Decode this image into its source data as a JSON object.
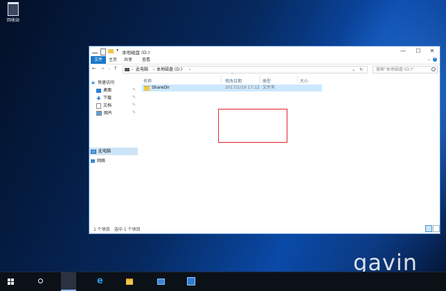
{
  "desktop": {
    "recycle_bin_label": "回收站",
    "watermark": "gavin"
  },
  "window": {
    "title": "本地磁盘 (D:)",
    "ribbon_tabs": [
      "文件",
      "主页",
      "共享",
      "查看"
    ],
    "address": {
      "crumbs": [
        "此电脑",
        "本地磁盘 (D:)"
      ]
    },
    "search_placeholder": "搜索\"本地磁盘 (D:)\"",
    "nav": {
      "quick_access": "快速访问",
      "desktop": "桌面",
      "downloads": "下载",
      "documents": "文档",
      "pictures": "图片",
      "this_pc": "此电脑",
      "network": "网络"
    },
    "columns": [
      "名称",
      "修改日期",
      "类型",
      "大小"
    ],
    "rows": [
      {
        "name": "ShareDir",
        "modified": "2017/2/19 17:12",
        "type": "文件夹",
        "size": ""
      }
    ],
    "status": {
      "item_count": "1 个项目",
      "selected": "选中 1 个项目"
    }
  },
  "colors": {
    "accent": "#1979ca",
    "selection": "#cce8ff",
    "highlight_box": "#e41e26"
  }
}
